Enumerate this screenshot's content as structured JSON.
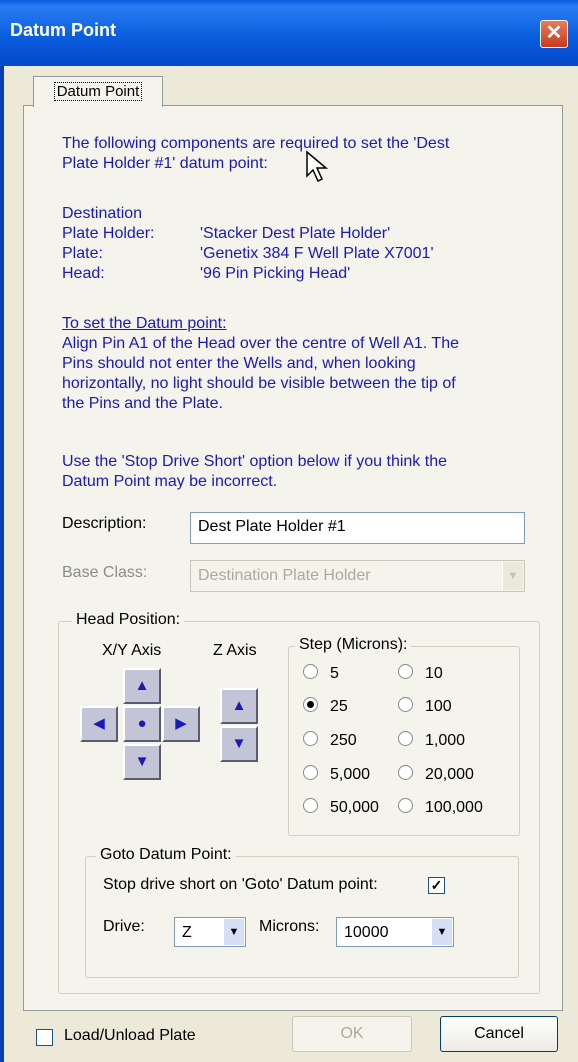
{
  "window": {
    "title": "Datum Point",
    "close_symbol": "✕"
  },
  "tab": {
    "label": "Datum Point"
  },
  "intro": {
    "line1": "The following components are required to set the 'Dest",
    "line2": "Plate Holder #1' datum point:"
  },
  "components": {
    "heading": "Destination",
    "rows": [
      {
        "label": "Plate Holder:",
        "value": "'Stacker Dest Plate Holder'"
      },
      {
        "label": "Plate:",
        "value": "'Genetix 384 F Well Plate X7001'"
      },
      {
        "label": "Head:",
        "value": "'96 Pin Picking Head'"
      }
    ]
  },
  "instructions": {
    "heading": "To set the Datum point:",
    "lines": [
      "Align Pin A1 of the Head over the centre of Well A1. The",
      "Pins should not enter the Wells and, when looking",
      "horizontally, no light should be visible between the tip of",
      "the Pins and the Plate."
    ],
    "note_lines": [
      "Use the 'Stop Drive Short' option below if you think the",
      "Datum Point may be incorrect."
    ]
  },
  "description": {
    "label": "Description:",
    "value": "Dest Plate Holder #1"
  },
  "base_class": {
    "label": "Base Class:",
    "value": "Destination Plate Holder"
  },
  "head_position": {
    "title": "Head Position:",
    "xy_label": "X/Y Axis",
    "z_label": "Z Axis",
    "arrows": {
      "up": "▲",
      "down": "▼",
      "left": "◀",
      "right": "▶",
      "center": "●"
    },
    "step": {
      "title": "Step (Microns):",
      "options": [
        "5",
        "10",
        "25",
        "100",
        "250",
        "1,000",
        "5,000",
        "20,000",
        "50,000",
        "100,000"
      ],
      "selected": "25"
    }
  },
  "goto": {
    "title": "Goto Datum Point:",
    "stop_short_label": "Stop drive short on 'Goto' Datum point:",
    "stop_short_checked": true,
    "check_mark": "✓",
    "drive_label": "Drive:",
    "drive_value": "Z",
    "microns_label": "Microns:",
    "microns_value": "10000",
    "dropdown_arrow": "▼"
  },
  "footer": {
    "load_unload_label": "Load/Unload Plate",
    "ok_label": "OK",
    "cancel_label": "Cancel"
  }
}
